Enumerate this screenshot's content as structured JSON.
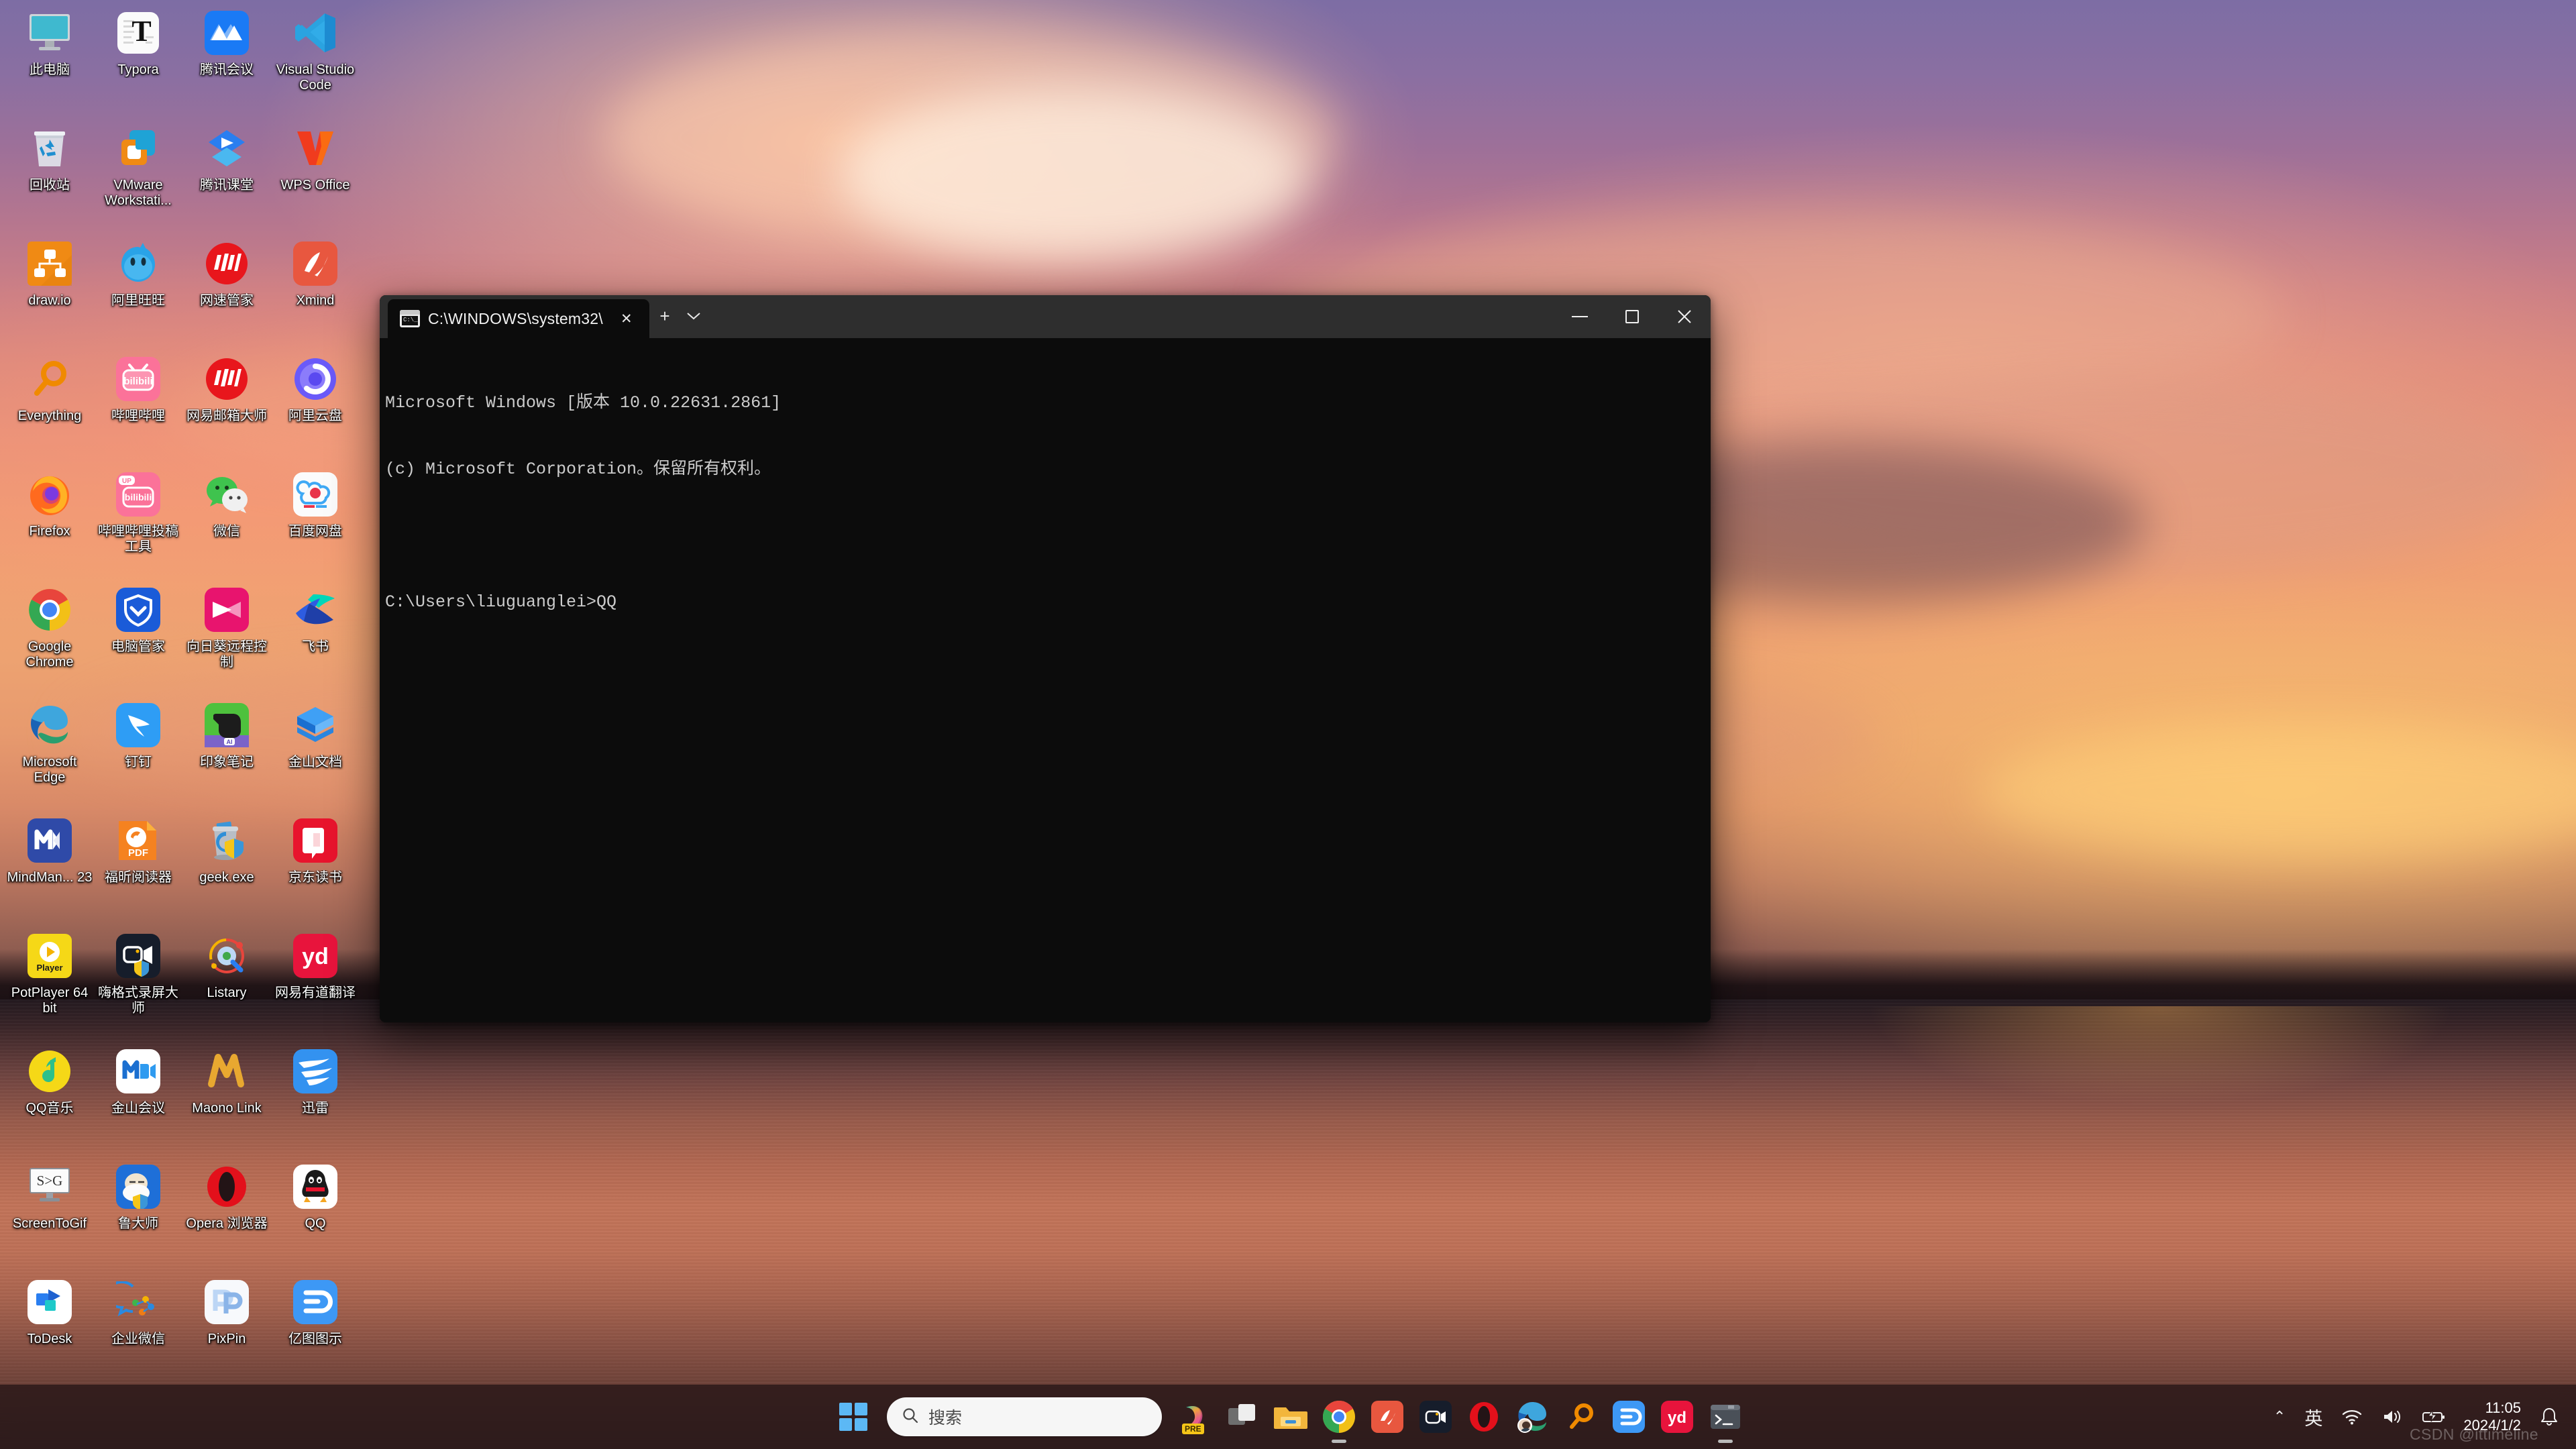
{
  "desktop": {
    "icons": [
      {
        "label": "此电脑",
        "icon": "this-pc-icon"
      },
      {
        "label": "Typora",
        "icon": "typora-icon"
      },
      {
        "label": "腾讯会议",
        "icon": "tencent-meeting-icon"
      },
      {
        "label": "Visual Studio Code",
        "icon": "vscode-icon"
      },
      {
        "label": "回收站",
        "icon": "recycle-bin-icon"
      },
      {
        "label": "VMware Workstati...",
        "icon": "vmware-icon"
      },
      {
        "label": "腾讯课堂",
        "icon": "tencent-ketang-icon"
      },
      {
        "label": "WPS Office",
        "icon": "wps-office-icon"
      },
      {
        "label": "draw.io",
        "icon": "drawio-icon"
      },
      {
        "label": "阿里旺旺",
        "icon": "aliwangwang-icon"
      },
      {
        "label": "网速管家",
        "icon": "wangsu-guanjia-icon"
      },
      {
        "label": "Xmind",
        "icon": "xmind-icon"
      },
      {
        "label": "Everything",
        "icon": "everything-icon"
      },
      {
        "label": "哔哩哔哩",
        "icon": "bilibili-icon"
      },
      {
        "label": "网易邮箱大师",
        "icon": "netease-mail-icon"
      },
      {
        "label": "阿里云盘",
        "icon": "aliyun-drive-icon"
      },
      {
        "label": "Firefox",
        "icon": "firefox-icon"
      },
      {
        "label": "哔哩哔哩投稿工具",
        "icon": "bilibili-upload-icon"
      },
      {
        "label": "微信",
        "icon": "wechat-icon"
      },
      {
        "label": "百度网盘",
        "icon": "baidu-netdisk-icon"
      },
      {
        "label": "Google Chrome",
        "icon": "chrome-icon"
      },
      {
        "label": "电脑管家",
        "icon": "pc-manager-icon"
      },
      {
        "label": "向日葵远程控制",
        "icon": "sunflower-remote-icon"
      },
      {
        "label": "飞书",
        "icon": "feishu-icon"
      },
      {
        "label": "Microsoft Edge",
        "icon": "edge-icon"
      },
      {
        "label": "钉钉",
        "icon": "dingtalk-icon"
      },
      {
        "label": "印象笔记",
        "icon": "evernote-icon"
      },
      {
        "label": "金山文档",
        "icon": "jinshan-docs-icon"
      },
      {
        "label": "MindMan... 23",
        "icon": "mindmanager-icon"
      },
      {
        "label": "福昕阅读器",
        "icon": "foxit-reader-icon"
      },
      {
        "label": "geek.exe",
        "icon": "geek-uninstaller-icon"
      },
      {
        "label": "京东读书",
        "icon": "jd-read-icon"
      },
      {
        "label": "PotPlayer 64 bit",
        "icon": "potplayer-icon"
      },
      {
        "label": "嗨格式录屏大师",
        "icon": "haigeshi-recorder-icon"
      },
      {
        "label": "Listary",
        "icon": "listary-icon"
      },
      {
        "label": "网易有道翻译",
        "icon": "youdao-translate-icon"
      },
      {
        "label": "QQ音乐",
        "icon": "qq-music-icon"
      },
      {
        "label": "金山会议",
        "icon": "jinshan-meeting-icon"
      },
      {
        "label": "Maono Link",
        "icon": "maono-link-icon"
      },
      {
        "label": "迅雷",
        "icon": "xunlei-icon"
      },
      {
        "label": "ScreenToGif",
        "icon": "screentogif-icon"
      },
      {
        "label": "鲁大师",
        "icon": "ludashi-icon"
      },
      {
        "label": "Opera 浏览器",
        "icon": "opera-icon"
      },
      {
        "label": "QQ",
        "icon": "qq-icon"
      },
      {
        "label": "ToDesk",
        "icon": "todesk-icon"
      },
      {
        "label": "企业微信",
        "icon": "wecom-icon"
      },
      {
        "label": "PixPin",
        "icon": "pixpin-icon"
      },
      {
        "label": "亿图图示",
        "icon": "edraw-icon"
      }
    ]
  },
  "terminal": {
    "tab_title": "C:\\WINDOWS\\system32\\",
    "tab_close_label": "✕",
    "new_tab_label": "+",
    "dropdown_label": "⌄",
    "minimize_label": "Minimize",
    "maximize_label": "Maximize",
    "close_label": "Close",
    "lines": [
      "Microsoft Windows [版本 10.0.22631.2861]",
      "(c) Microsoft Corporation。保留所有权利。",
      "",
      "C:\\Users\\liuguanglei>QQ"
    ]
  },
  "taskbar": {
    "start_label": "开始",
    "search_placeholder": "搜索",
    "items": [
      {
        "name": "copilot",
        "label": "Copilot",
        "badge": "PRE"
      },
      {
        "name": "task-view",
        "label": "任务视图"
      },
      {
        "name": "file-explorer",
        "label": "文件资源管理器"
      },
      {
        "name": "chrome",
        "label": "Google Chrome",
        "running": true
      },
      {
        "name": "xmind",
        "label": "Xmind"
      },
      {
        "name": "haigeshi-recorder",
        "label": "嗨格式录屏大师"
      },
      {
        "name": "opera",
        "label": "Opera"
      },
      {
        "name": "edge",
        "label": "Microsoft Edge"
      },
      {
        "name": "everything",
        "label": "Everything"
      },
      {
        "name": "edraw",
        "label": "亿图图示"
      },
      {
        "name": "youdao",
        "label": "网易有道翻译"
      },
      {
        "name": "terminal",
        "label": "终端",
        "running": true
      }
    ],
    "tray": {
      "chevron": "⌃",
      "ime": "英",
      "wifi_label": "网络",
      "volume_label": "音量",
      "battery_label": "电池",
      "time": "11:05",
      "date": "2024/1/2",
      "notification_label": "通知"
    }
  },
  "watermark": "CSDN @ittimeline",
  "colors": {
    "accent": "#5cb8f5",
    "taskbar_bg": "#2c1a1a",
    "terminal_bg": "#0c0c0c",
    "titlebar_bg": "#2e2e2e"
  }
}
